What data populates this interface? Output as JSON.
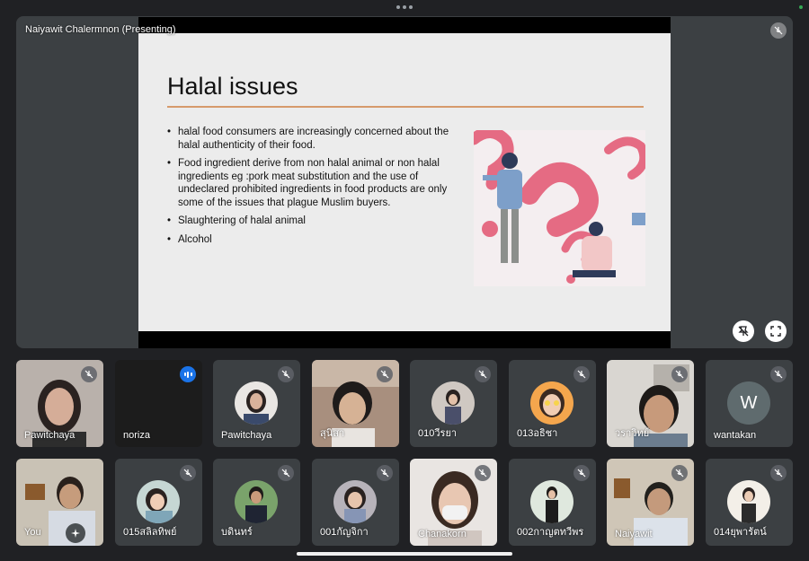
{
  "window": {
    "presenter_label": "Naiyawit Chalermnon (Presenting)"
  },
  "slide": {
    "title": "Halal issues",
    "bullets": [
      "halal food consumers are increasingly concerned about the halal authenticity of their food.",
      "Food ingredient derive from non halal animal or non halal ingredients  eg :pork meat substitution and the use of undeclared prohibited ingredients  in food products are only some of the issues that plague Muslim buyers.",
      "Slaughtering of halal animal",
      "Alcohol"
    ],
    "accent_color": "#d69a6b"
  },
  "participants_row1": [
    {
      "name": "Pawitchaya",
      "status": "muted",
      "kind": "video"
    },
    {
      "name": "noriza",
      "status": "speaking",
      "kind": "blank"
    },
    {
      "name": "Pawitchaya",
      "status": "muted",
      "kind": "avatar"
    },
    {
      "name": "สุนิสา",
      "status": "muted",
      "kind": "video"
    },
    {
      "name": "010วีรยา",
      "status": "muted",
      "kind": "avatar"
    },
    {
      "name": "013อธิชา",
      "status": "muted",
      "kind": "avatar"
    },
    {
      "name": "วราวิทย์",
      "status": "muted",
      "kind": "video"
    },
    {
      "name": "wantakan",
      "status": "muted",
      "kind": "letter",
      "letter": "W"
    }
  ],
  "participants_row2": [
    {
      "name": "You",
      "status": "effects",
      "kind": "video"
    },
    {
      "name": "015สลิลทิพย์",
      "status": "muted",
      "kind": "avatar"
    },
    {
      "name": "บดินทร์",
      "status": "muted",
      "kind": "avatar"
    },
    {
      "name": "001กัญจิกา",
      "status": "muted",
      "kind": "avatar"
    },
    {
      "name": "Chanakorn",
      "status": "muted",
      "kind": "video"
    },
    {
      "name": "002กาญตทวีพร",
      "status": "muted",
      "kind": "avatar"
    },
    {
      "name": "Naiyawit",
      "status": "muted",
      "kind": "video"
    },
    {
      "name": "014ยุพารัตน์",
      "status": "muted",
      "kind": "avatar"
    }
  ],
  "colors": {
    "speaking": "#1a73e8",
    "stage_bg": "#3c4043",
    "page_bg": "#202124"
  }
}
